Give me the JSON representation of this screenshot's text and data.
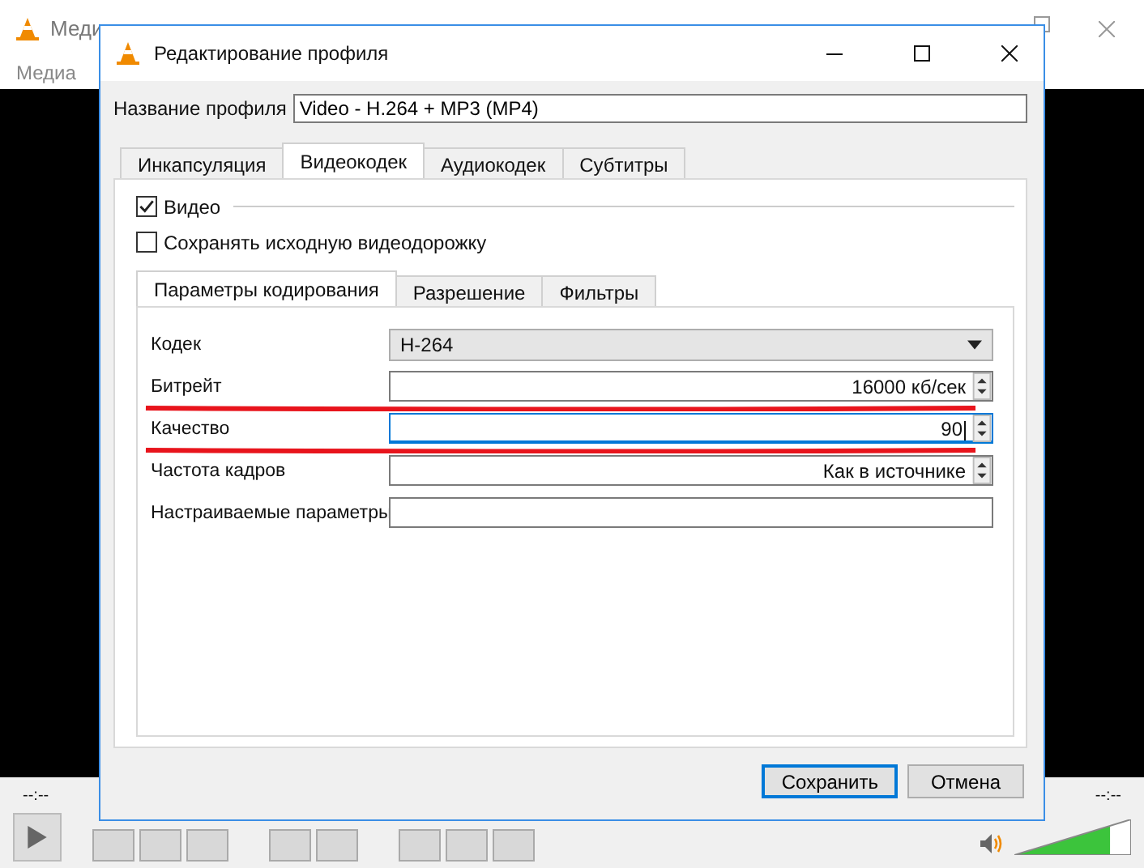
{
  "player": {
    "title": "Меди",
    "menu": [
      "Медиа"
    ],
    "time_elapsed": "--:--",
    "time_total": "--:--",
    "volume": {
      "level": 0.82
    }
  },
  "dialog": {
    "title": "Редактирование профиля",
    "profile_label": "Название профиля",
    "profile_name": "Video - H.264 + MP3 (MP4)",
    "tabs": [
      {
        "label": "Инкапсуляция",
        "selected": false
      },
      {
        "label": "Видеокодек",
        "selected": true
      },
      {
        "label": "Аудиокодек",
        "selected": false
      },
      {
        "label": "Субтитры",
        "selected": false
      }
    ],
    "video": {
      "label": "Видео",
      "checked": true
    },
    "keep_original": {
      "label": "Сохранять исходную видеодорожку",
      "checked": false
    },
    "subtabs": [
      {
        "label": "Параметры кодирования",
        "selected": true
      },
      {
        "label": "Разрешение",
        "selected": false
      },
      {
        "label": "Фильтры",
        "selected": false
      }
    ],
    "fields": [
      {
        "label": "Кодек",
        "kind": "combo",
        "value": "H-264",
        "underlined": false,
        "focused": false
      },
      {
        "label": "Битрейт",
        "kind": "spin",
        "value": "16000 кб/сек",
        "underlined": true,
        "focused": false
      },
      {
        "label": "Качество",
        "kind": "spin",
        "value": "90",
        "underlined": true,
        "focused": true
      },
      {
        "label": "Частота кадров",
        "kind": "spin",
        "value": "Как в источнике",
        "underlined": false,
        "focused": false
      },
      {
        "label": "Настраиваемые параметры",
        "kind": "text",
        "underlined": false,
        "focused": false
      }
    ],
    "buttons": [
      {
        "label": "Сохранить",
        "default": true
      },
      {
        "label": "Отмена",
        "default": false
      }
    ]
  }
}
